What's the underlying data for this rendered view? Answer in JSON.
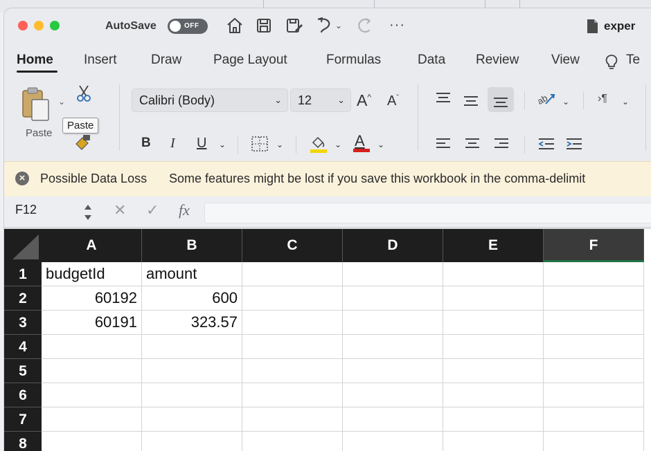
{
  "titlebar": {
    "autosave_label": "AutoSave",
    "autosave_state": "OFF",
    "filename": "exper",
    "icons": [
      "home-icon",
      "save-icon",
      "save-as-icon",
      "undo-icon",
      "redo-icon",
      "more-icon"
    ],
    "more_label": "···",
    "colors": {
      "close": "#fe5f57",
      "minimize": "#febc2e",
      "zoom": "#28c840"
    }
  },
  "tabs": [
    {
      "label": "Home"
    },
    {
      "label": "Insert"
    },
    {
      "label": "Draw"
    },
    {
      "label": "Page Layout"
    },
    {
      "label": "Formulas"
    },
    {
      "label": "Data"
    },
    {
      "label": "Review"
    },
    {
      "label": "View"
    },
    {
      "label": "Te"
    }
  ],
  "ribbon": {
    "paste_label": "Paste",
    "tooltip": "Paste",
    "font_name": "Calibri (Body)",
    "font_size": "12",
    "bold": "B",
    "italic": "I",
    "underline": "U",
    "grow_font": "A",
    "shrink_font": "A",
    "font_color_letter": "A"
  },
  "warning": {
    "title": "Possible Data Loss",
    "message": "Some features might be lost if you save this workbook in the comma-delimit"
  },
  "formula_bar": {
    "name_box": "F12",
    "fx": "fx",
    "cancel": "✕",
    "enter": "✓",
    "value": ""
  },
  "sheet": {
    "columns": [
      "A",
      "B",
      "C",
      "D",
      "E",
      "F"
    ],
    "selected_column": "F",
    "rows": [
      "1",
      "2",
      "3",
      "4",
      "5",
      "6",
      "7",
      "8"
    ],
    "cells": [
      [
        "budgetId",
        "amount",
        "",
        "",
        "",
        ""
      ],
      [
        "60192",
        "600",
        "",
        "",
        "",
        ""
      ],
      [
        "60191",
        "323.57",
        "",
        "",
        "",
        ""
      ],
      [
        "",
        "",
        "",
        "",
        "",
        ""
      ],
      [
        "",
        "",
        "",
        "",
        "",
        ""
      ],
      [
        "",
        "",
        "",
        "",
        "",
        ""
      ],
      [
        "",
        "",
        "",
        "",
        "",
        ""
      ],
      [
        "",
        "",
        "",
        "",
        "",
        ""
      ]
    ]
  }
}
